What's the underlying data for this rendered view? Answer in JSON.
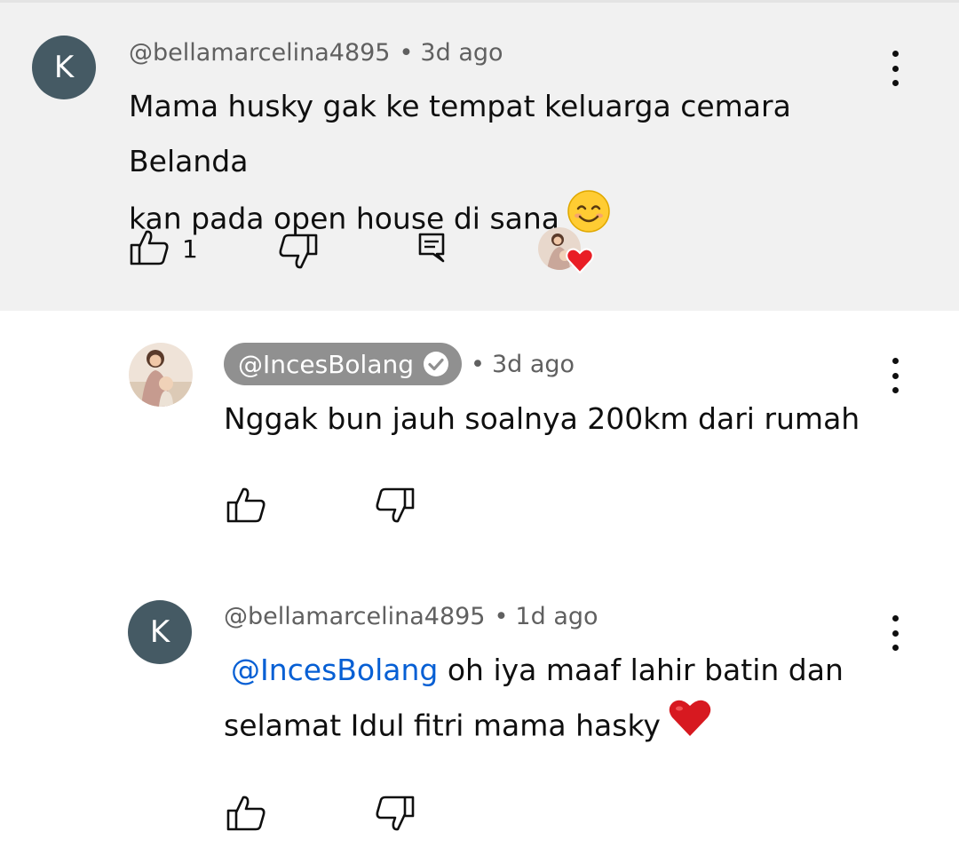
{
  "comments": [
    {
      "author": "@bellamarcelina4895",
      "avatar_letter": "K",
      "time": "3d ago",
      "text_line1": "Mama husky gak ke tempat keluarga cemara Belanda",
      "text_line2": "kan pada open house di sana",
      "emoji": "smiling-face-emoji",
      "like_count": "1",
      "hearted_by_creator": true
    },
    {
      "author": "@IncesBolang",
      "verified": true,
      "time": "3d ago",
      "text": "Nggak bun jauh soalnya 200km dari rumah"
    },
    {
      "author": "@bellamarcelina4895",
      "avatar_letter": "K",
      "time": "1d ago",
      "mention": "@IncesBolang",
      "text_line1": " oh iya maaf lahir batin dan",
      "text_line2": "selamat Idul fitri mama hasky",
      "emoji": "red-heart-emoji"
    }
  ],
  "separator": "•",
  "colors": {
    "parent_bg": "#f1f1f1",
    "avatar_bg": "#455a64",
    "meta_gray": "#606060",
    "creator_pill": "#909090",
    "mention_blue": "#065fd4",
    "heart_red": "#e91e25"
  }
}
